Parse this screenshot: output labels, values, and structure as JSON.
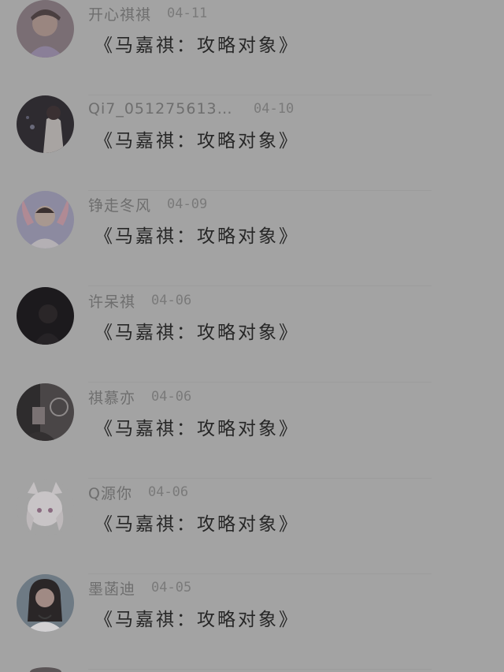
{
  "comments": [
    {
      "name": "开心祺祺",
      "date": "04-11",
      "message": "《马嘉祺：攻略对象》",
      "avatar": "avatar-image"
    },
    {
      "name": "Qi7_05127561300…",
      "date": "04-10",
      "message": "《马嘉祺：攻略对象》",
      "avatar": "avatar-image"
    },
    {
      "name": "铮走冬风",
      "date": "04-09",
      "message": "《马嘉祺：攻略对象》",
      "avatar": "avatar-image"
    },
    {
      "name": "许呆祺",
      "date": "04-06",
      "message": "《马嘉祺：攻略对象》",
      "avatar": "avatar-image"
    },
    {
      "name": "祺慕亦",
      "date": "04-06",
      "message": "《马嘉祺：攻略对象》",
      "avatar": "avatar-image"
    },
    {
      "name": "Q源你",
      "date": "04-06",
      "message": "《马嘉祺：攻略对象》",
      "avatar": "avatar-image"
    },
    {
      "name": "墨菡迪",
      "date": "04-05",
      "message": "《马嘉祺：攻略对象》",
      "avatar": "avatar-image"
    }
  ]
}
